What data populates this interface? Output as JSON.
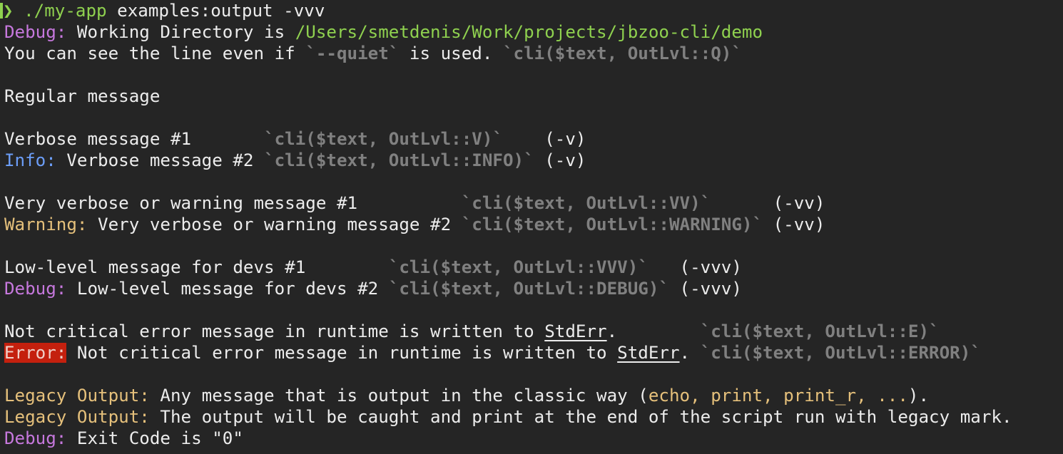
{
  "prompt": {
    "symbol": "❯",
    "path": "./my-app",
    "args": " examples:output -vvv"
  },
  "lines": {
    "l1": {
      "prefix": "Debug:",
      "text": " Working Directory is ",
      "path": "/Users/smetdenis/Work/projects/jbzoo-cli/demo"
    },
    "l2": {
      "a": "You can see the line even if ",
      "b": "`--quiet`",
      "c": " is used. ",
      "d": "`cli($text, OutLvl::Q)`"
    },
    "l3": {
      "text": "Regular message"
    },
    "l4": {
      "text": "Verbose message #1       ",
      "code": "`cli($text, OutLvl::V)`",
      "flag": "    (-v)"
    },
    "l5": {
      "prefix": "Info:",
      "text": " Verbose message #2 ",
      "code": "`cli($text, OutLvl::INFO)`",
      "flag": " (-v)"
    },
    "l6": {
      "text": "Very verbose or warning message #1          ",
      "code": "`cli($text, OutLvl::VV)`",
      "flag": "      (-vv)"
    },
    "l7": {
      "prefix": "Warning:",
      "text": " Very verbose or warning message #2 ",
      "code": "`cli($text, OutLvl::WARNING)`",
      "flag": " (-vv)"
    },
    "l8": {
      "text": "Low-level message for devs #1        ",
      "code": "`cli($text, OutLvl::VVV)`",
      "flag": "   (-vvv)"
    },
    "l9": {
      "prefix": "Debug:",
      "text": " Low-level message for devs #2 ",
      "code": "`cli($text, OutLvl::DEBUG)`",
      "flag": " (-vvv)"
    },
    "l10": {
      "text": "Not critical error message in runtime is written to ",
      "link": "StdErr",
      "after": ".        ",
      "code": "`cli($text, OutLvl::E)`"
    },
    "l11": {
      "prefix": "Error:",
      "text": " Not critical error message in runtime is written to ",
      "link": "StdErr",
      "after": ". ",
      "code": "`cli($text, OutLvl::ERROR)`"
    },
    "l12": {
      "prefix": "Legacy Output:",
      "text": " Any message that is output in the classic way (",
      "funcs": "echo, print, print_r, ...",
      "after": ")."
    },
    "l13": {
      "prefix": "Legacy Output:",
      "text": " The output will be caught and print at the end of the script run with legacy mark."
    },
    "l14": {
      "prefix": "Debug:",
      "text": " Exit Code is \"0\""
    }
  },
  "colors": {
    "background": "#252525",
    "text": "#ececec",
    "green": "#8fd14f",
    "purple": "#c678dd",
    "blue": "#6c9ef8",
    "yellow": "#e5c07b",
    "gray": "#808080",
    "error_bg": "#c4200e"
  }
}
